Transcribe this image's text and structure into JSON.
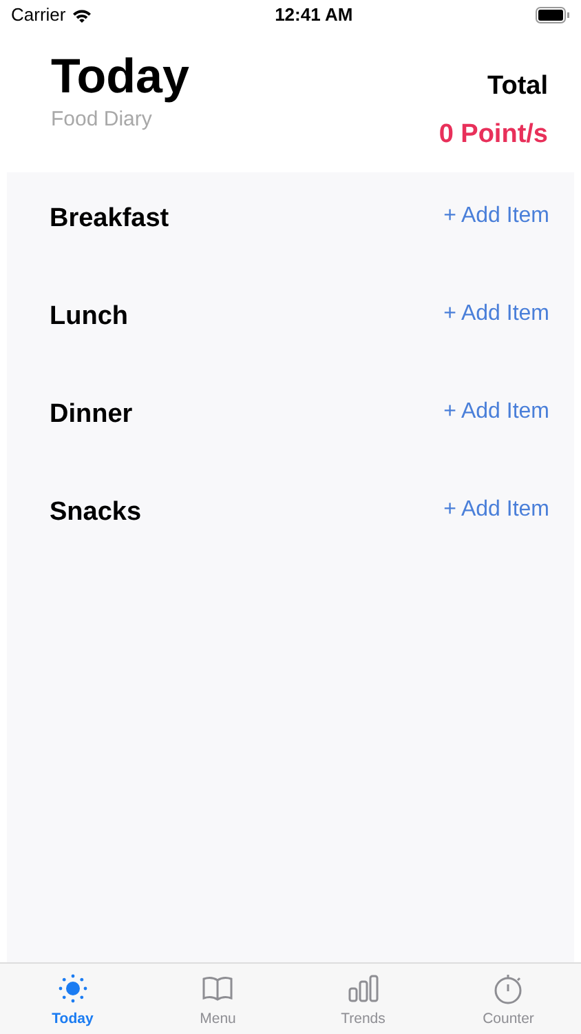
{
  "status_bar": {
    "carrier": "Carrier",
    "time": "12:41 AM"
  },
  "header": {
    "title": "Today",
    "subtitle": "Food Diary",
    "total_label": "Total",
    "total_value": "0 Point/s"
  },
  "meals": [
    {
      "name": "Breakfast",
      "action": "+ Add Item"
    },
    {
      "name": "Lunch",
      "action": "+ Add Item"
    },
    {
      "name": "Dinner",
      "action": "+ Add Item"
    },
    {
      "name": "Snacks",
      "action": "+ Add Item"
    }
  ],
  "tabs": [
    {
      "label": "Today",
      "kind": "sun",
      "selected": true
    },
    {
      "label": "Menu",
      "kind": "book",
      "selected": false
    },
    {
      "label": "Trends",
      "kind": "bars",
      "selected": false
    },
    {
      "label": "Counter",
      "kind": "stopwatch",
      "selected": false
    }
  ]
}
